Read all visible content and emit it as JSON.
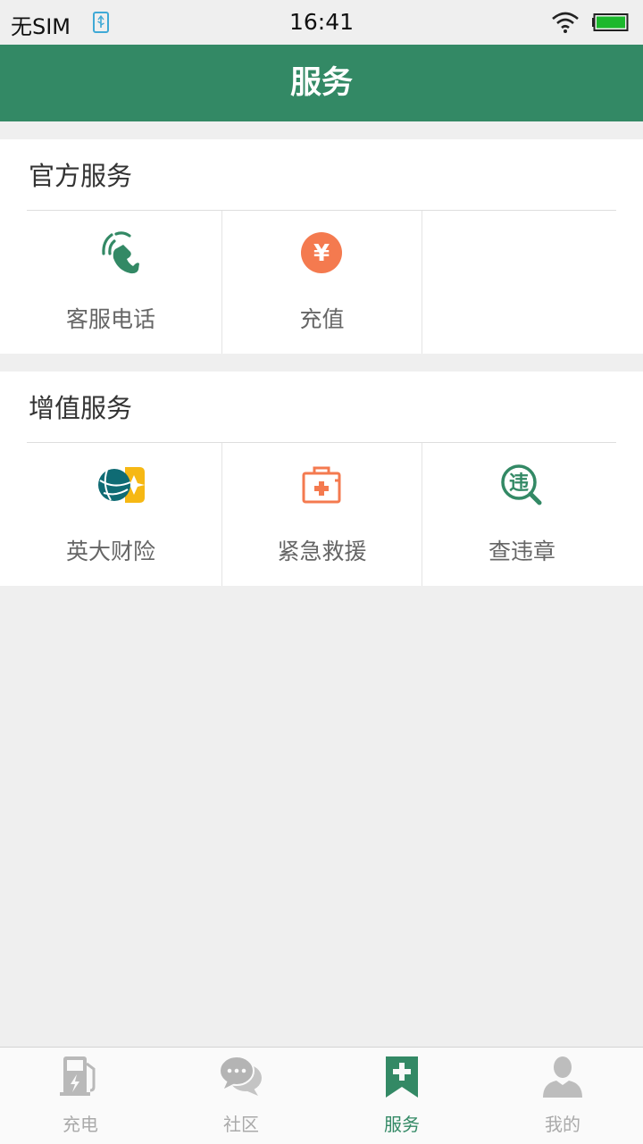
{
  "status_bar": {
    "carrier": "无SIM",
    "time": "16:41",
    "icons": [
      "usb-icon",
      "wifi-icon",
      "battery-icon"
    ]
  },
  "header": {
    "title": "服务"
  },
  "sections": [
    {
      "title": "官方服务",
      "items": [
        {
          "label": "客服电话",
          "icon": "phone-icon"
        },
        {
          "label": "充值",
          "icon": "yuan-icon",
          "icon_symbol": "¥"
        }
      ]
    },
    {
      "title": "增值服务",
      "items": [
        {
          "label": "英大财险",
          "icon": "insurance-logo-icon"
        },
        {
          "label": "紧急救援",
          "icon": "first-aid-kit-icon"
        },
        {
          "label": "查违章",
          "icon": "violation-search-icon",
          "icon_char": "违"
        }
      ]
    }
  ],
  "tabbar": {
    "active": "服务",
    "tabs": [
      {
        "label": "充电",
        "icon": "charging-station-icon"
      },
      {
        "label": "社区",
        "icon": "chat-bubbles-icon"
      },
      {
        "label": "服务",
        "icon": "service-bookmark-icon"
      },
      {
        "label": "我的",
        "icon": "user-icon"
      }
    ]
  },
  "colors": {
    "brand_green": "#338965",
    "accent_orange": "#f47a4f",
    "inactive_gray": "#aaaaaa",
    "background": "#efefef"
  }
}
